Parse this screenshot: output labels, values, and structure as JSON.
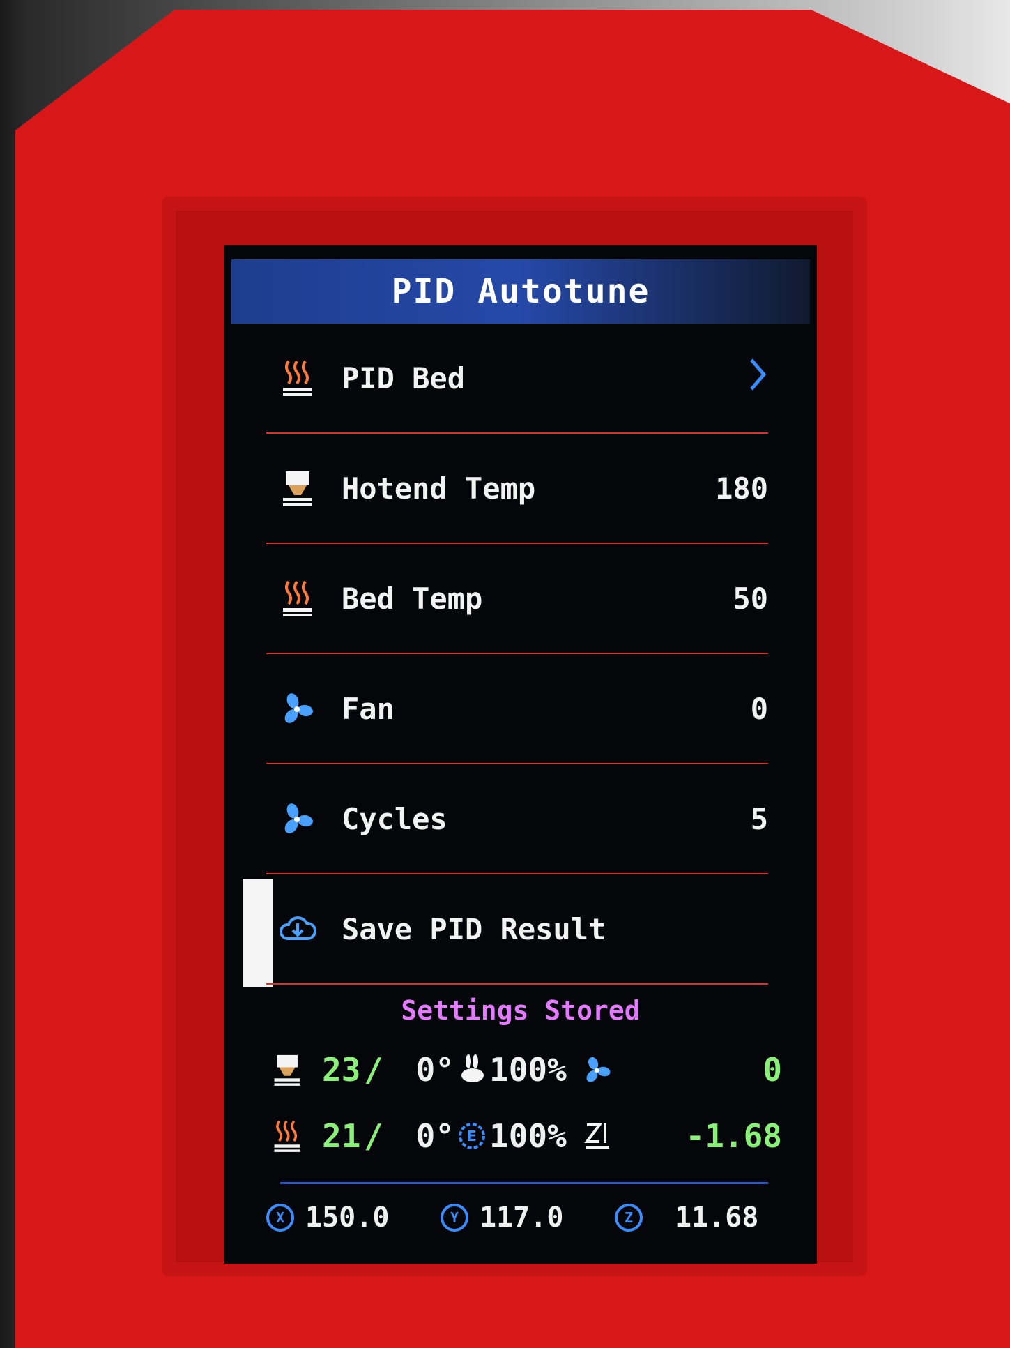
{
  "screen": {
    "title": "PID Autotune",
    "menu": [
      {
        "label": "PID Bed",
        "value": "",
        "icon": "heated-bed-icon",
        "has_arrow": true
      },
      {
        "label": "Hotend Temp",
        "value": "180",
        "icon": "hotend-icon"
      },
      {
        "label": "Bed Temp",
        "value": "50",
        "icon": "heated-bed-icon"
      },
      {
        "label": "Fan",
        "value": "0",
        "icon": "fan-icon"
      },
      {
        "label": "Cycles",
        "value": "5",
        "icon": "fan-icon"
      },
      {
        "label": "Save PID Result",
        "value": "",
        "icon": "save-cloud-icon",
        "selected": true
      }
    ],
    "status_message": "Settings Stored",
    "status": {
      "hotend_current": "23",
      "hotend_target": "0°",
      "speed_percent": "100%",
      "fan_speed": "0",
      "bed_current": "21",
      "bed_target": "0°",
      "flow_percent": "100%",
      "z_offset": "-1.68"
    },
    "axes": {
      "x": "150.0",
      "y": "117.0",
      "z": "11.68",
      "x_label": "X",
      "y_label": "Y",
      "z_label": "Z"
    }
  },
  "colors": {
    "frame": "#d81818",
    "title_bar": "#2549a8",
    "divider": "#d8332b",
    "status_message": "#e27bff",
    "temp_value": "#8af07a",
    "accent": "#3b8cff"
  }
}
